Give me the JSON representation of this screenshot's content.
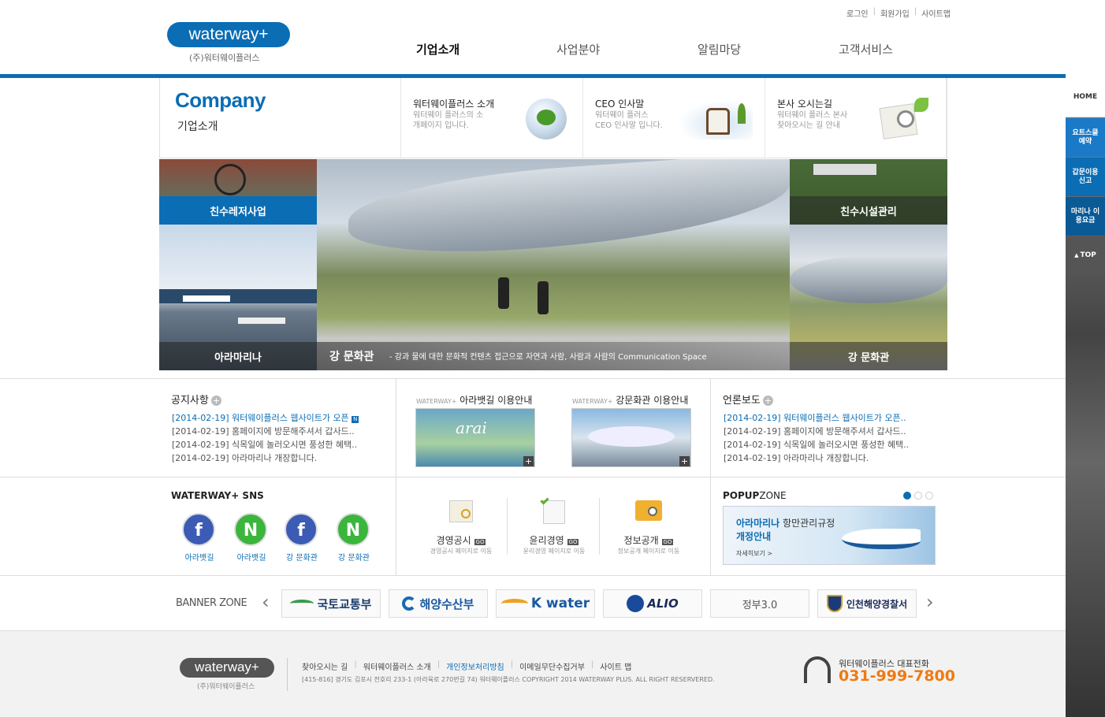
{
  "header": {
    "util": [
      "로그인",
      "회원가입",
      "사이트맵"
    ],
    "logo": "waterway+",
    "logo_sub": "(주)워터웨이플러스",
    "gnb": [
      "기업소개",
      "사업분야",
      "알림마당",
      "고객서비스"
    ]
  },
  "company": {
    "title": "Company",
    "subtitle": "기업소개",
    "boxes": [
      {
        "title": "워터웨이플러스 소개",
        "desc": "워터웨이 플러스의 소개페이지 입니다."
      },
      {
        "title": "CEO 인사말",
        "desc": "워터웨이 플러스 CEO 인사말 입니다."
      },
      {
        "title": "본사 오시는길",
        "desc": "워터웨이 플러스 본사 찾아오시는 길 안내"
      }
    ]
  },
  "visual": {
    "left_top": "친수레저사업",
    "left_bottom": "아라마리나",
    "main_title": "강 문화관",
    "main_desc": "- 강과 물에 대한 문화적 컨텐츠 접근으로 자연과 사람, 사람과 사람의 Communication Space",
    "right_top": "친수시설관리",
    "right_bottom": "강 문화관"
  },
  "notice": {
    "title": "공지사항",
    "items": [
      "[2014-02-19] 워터웨이플러스 웹사이트가 오픈",
      "[2014-02-19] 홈페이지에 방문해주셔서 갑사드..",
      "[2014-02-19] 식목일에 놀러오시면 풍성한 혜택..",
      "[2014-02-19] 아라마리나 개장합니다."
    ]
  },
  "guides": [
    {
      "brand": "WATERWAY+",
      "title": "아라뱃길 이용안내",
      "img": "arai"
    },
    {
      "brand": "WATERWAY+",
      "title": "강문화관 이용안내",
      "img": ""
    }
  ],
  "press": {
    "title": "언론보도",
    "items": [
      "[2014-02-19] 워터웨이플러스 웹사이트가 오픈..",
      "[2014-02-19] 홈페이지에 방문해주셔서 갑사드..",
      "[2014-02-19] 식목일에 놀러오시면 풍성한 혜택..",
      "[2014-02-19] 아라마리나 개장합니다."
    ]
  },
  "sns": {
    "title": "WATERWAY+ SNS",
    "items": [
      {
        "letter": "f",
        "label": "아라뱃길",
        "color": "#3b5bb5"
      },
      {
        "letter": "N",
        "label": "아라뱃길",
        "color": "#3bb53b"
      },
      {
        "letter": "f",
        "label": "강 문화관",
        "color": "#3b5bb5"
      },
      {
        "letter": "N",
        "label": "강 문화관",
        "color": "#3bb53b"
      }
    ]
  },
  "mgmt": [
    {
      "title": "경영공시",
      "desc": "경영공시 페이지로 이동",
      "go": "GO"
    },
    {
      "title": "윤리경영",
      "desc": "윤리경영 페이지로 이동",
      "go": "GO"
    },
    {
      "title": "정보공개",
      "desc": "정보공개 페이지로 이동",
      "go": "GO"
    }
  ],
  "popup": {
    "title_a": "POPUP",
    "title_b": "ZONE",
    "line1a": "아라마리나",
    "line1b": "항만관리규정",
    "line2": "개정안내",
    "more": "자세히보기 >"
  },
  "banner": {
    "title": "BANNER ZONE",
    "items": [
      "국토교통부",
      "해양수산부",
      "K water",
      "ALIO",
      "정부3.0",
      "인천해양경찰서"
    ],
    "prev": "‹",
    "next": "›"
  },
  "quick": [
    "HOME",
    "요트스쿨 예약",
    "갑문이용 신고",
    "마리나 이용요금",
    "TOP"
  ],
  "footer": {
    "logo": "waterway+",
    "logo_sub": "(주)워터웨이플러스",
    "links": [
      "찾아오시는 길",
      "워터웨이플러스 소개",
      "개인정보처리방침",
      "이메일무단수집거부",
      "사이트 맵"
    ],
    "address": "[415-816] 경기도 김포시 전호리 233-1 (아라육로 270번길 74) 워터웨이플러스 COPYRIGHT 2014 WATERWAY PLUS. ALL RIGHT RESERVERED.",
    "tel_label": "워터웨이플러스 대표전화",
    "tel": "031-999-7800"
  }
}
